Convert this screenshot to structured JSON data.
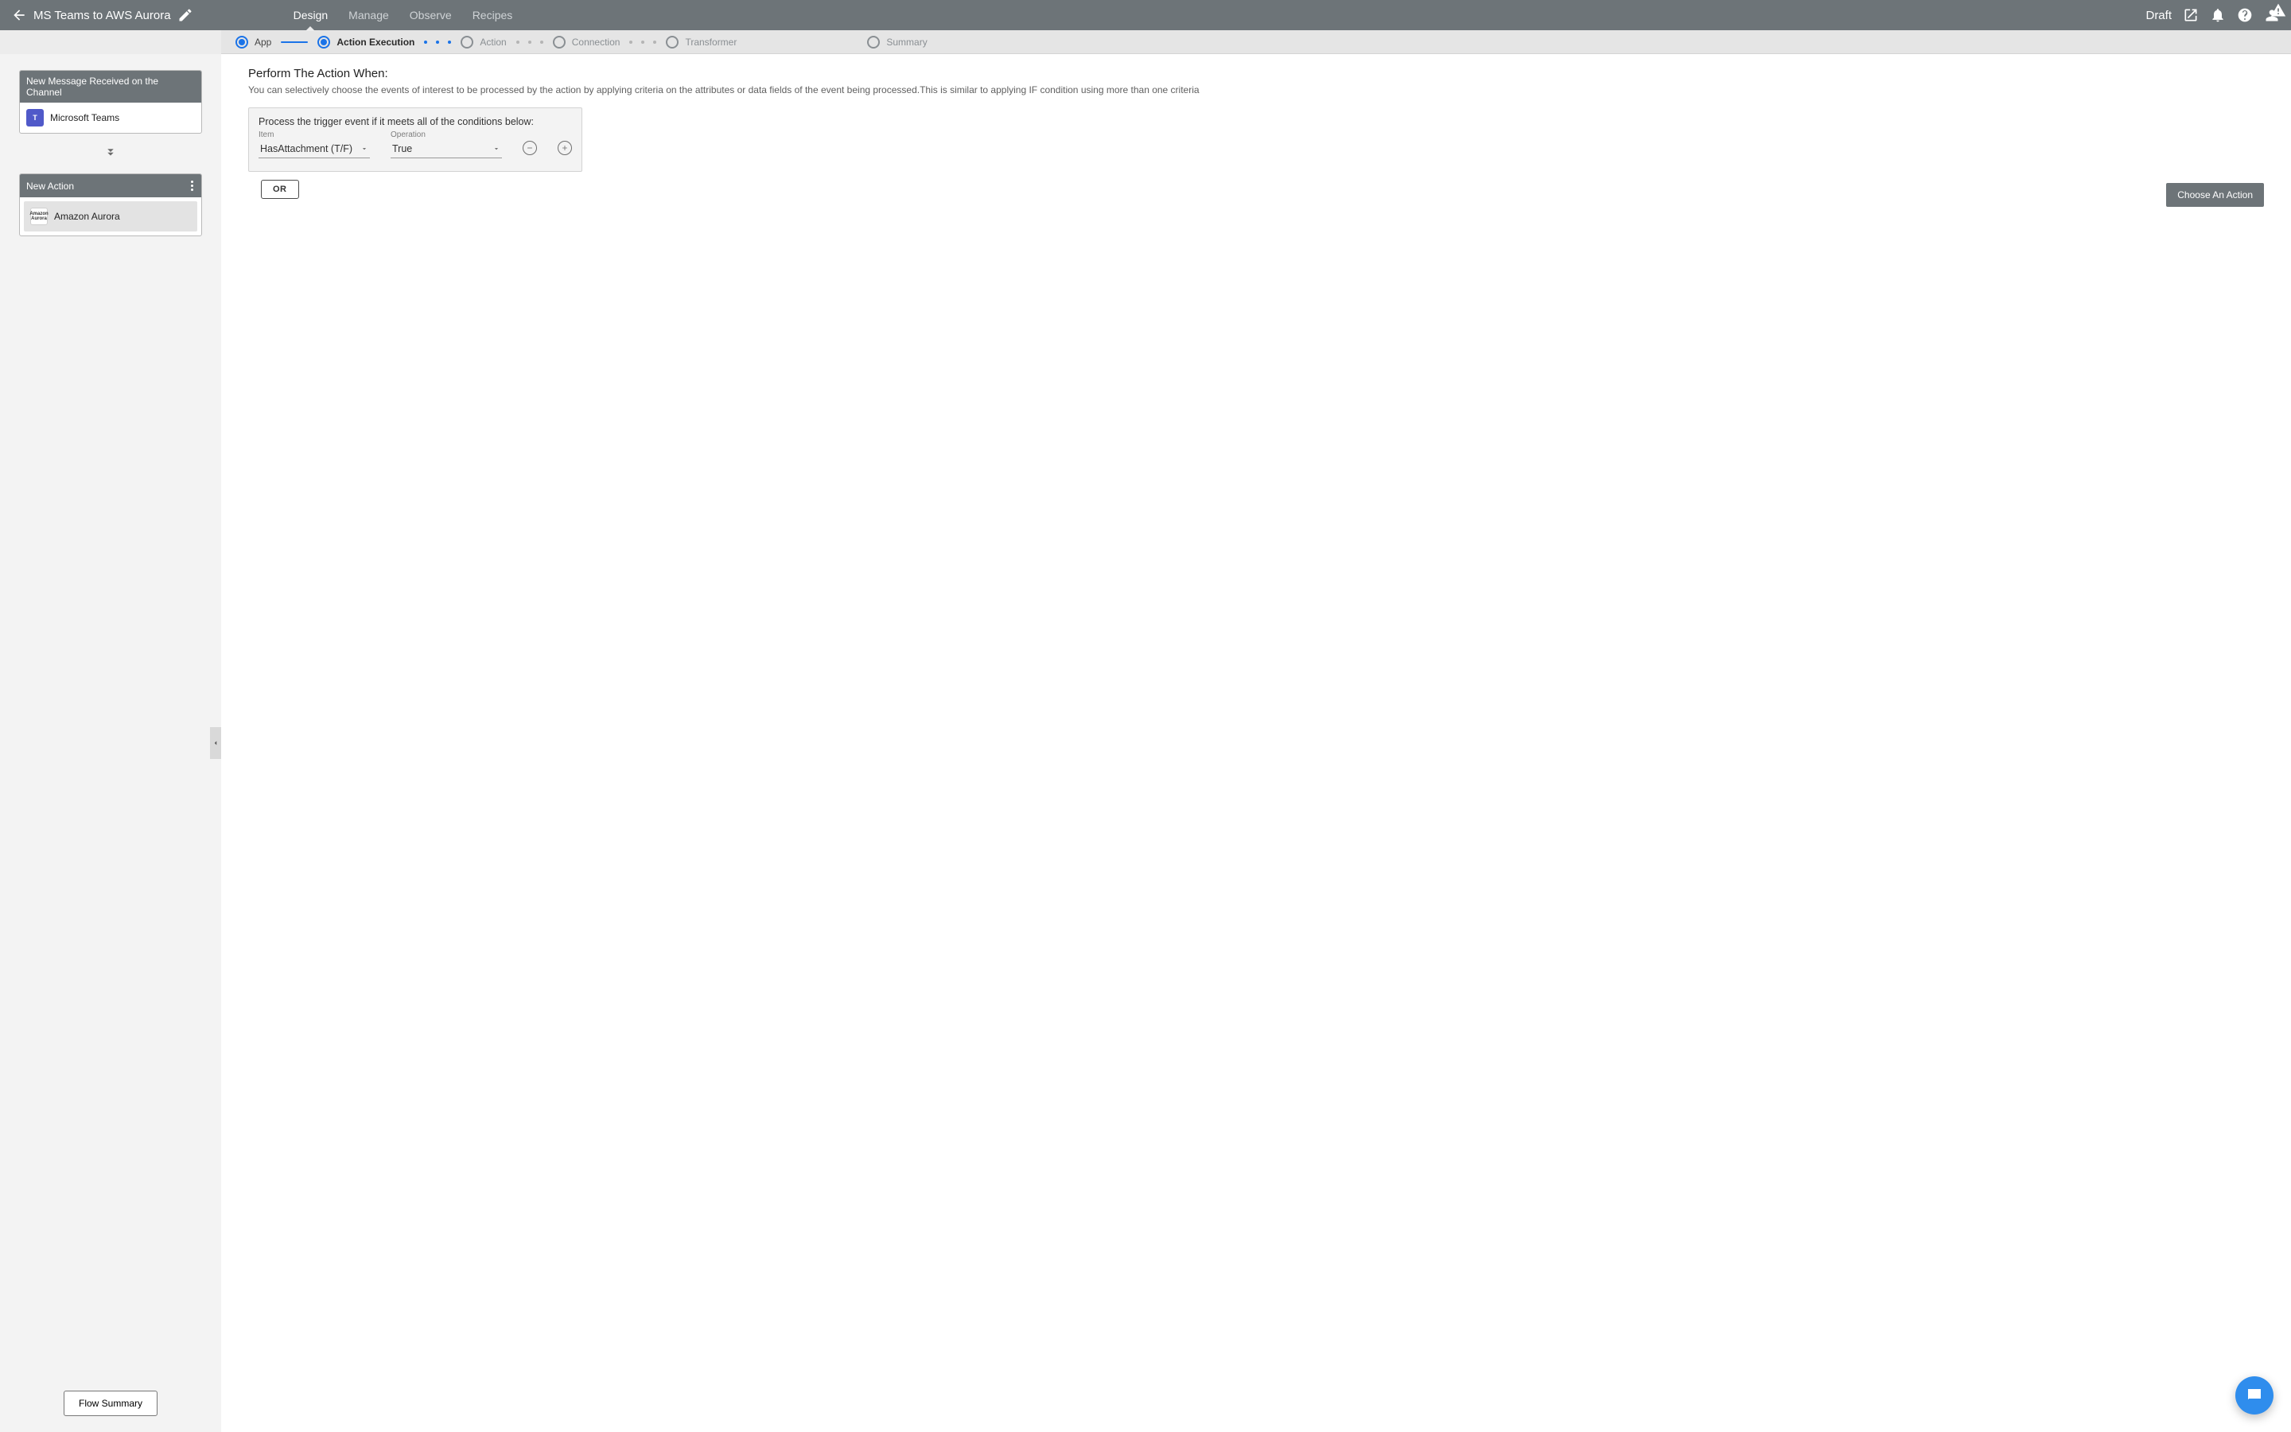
{
  "header": {
    "title": "MS Teams to AWS Aurora",
    "status": "Draft",
    "tabs": [
      {
        "label": "Design",
        "active": true
      },
      {
        "label": "Manage",
        "active": false
      },
      {
        "label": "Observe",
        "active": false
      },
      {
        "label": "Recipes",
        "active": false
      }
    ]
  },
  "stepper": [
    {
      "label": "App",
      "state": "done"
    },
    {
      "label": "Action Execution",
      "state": "active"
    },
    {
      "label": "Action",
      "state": "pending"
    },
    {
      "label": "Connection",
      "state": "pending"
    },
    {
      "label": "Transformer",
      "state": "pending"
    },
    {
      "label": "Summary",
      "state": "pending"
    }
  ],
  "sidebar": {
    "trigger_card": {
      "title": "New Message Received on the Channel",
      "app_label": "Microsoft Teams"
    },
    "action_card": {
      "title": "New Action",
      "app_label": "Amazon Aurora"
    },
    "flow_summary_label": "Flow Summary"
  },
  "main": {
    "section_title": "Perform The Action When:",
    "section_help": "You can selectively choose the events of interest to be processed by the action by applying criteria on the attributes or data fields of the event being processed.This is similar to applying IF condition using more than one criteria",
    "condition": {
      "prompt": "Process the trigger event if it meets all of the conditions below:",
      "item_label": "Item",
      "item_value": "HasAttachment (T/F)",
      "operation_label": "Operation",
      "operation_value": "True",
      "or_label": "OR"
    },
    "choose_action_label": "Choose An Action"
  }
}
